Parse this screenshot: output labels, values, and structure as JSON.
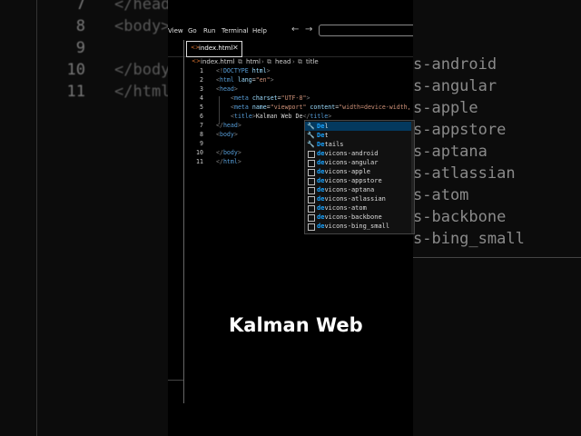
{
  "background_code": {
    "lines": [
      {
        "num": "7",
        "code": "</head"
      },
      {
        "num": "8",
        "code": "<body>"
      },
      {
        "num": "9",
        "code": ""
      },
      {
        "num": "10",
        "code": "</body"
      },
      {
        "num": "11",
        "code": "</html"
      }
    ],
    "suggestions": [
      "s-android",
      "s-angular",
      "s-apple",
      "s-appstore",
      "s-aptana",
      "s-atlassian",
      "s-atom",
      "s-backbone",
      "s-bing_small"
    ]
  },
  "menu": {
    "items": [
      "View",
      "Go",
      "Run",
      "Terminal",
      "Help"
    ],
    "back_icon": "arrow-left-icon",
    "forward_icon": "arrow-right-icon"
  },
  "tab": {
    "label": "index.html",
    "icon": "html-file-icon"
  },
  "breadcrumb": [
    "index.html",
    "html",
    "head",
    "title"
  ],
  "code_lines": [
    {
      "n": "1",
      "indent": 0,
      "parts": [
        [
          "tag",
          "<!"
        ],
        [
          "tn",
          "DOCTYPE"
        ],
        [
          "tx",
          " "
        ],
        [
          "an",
          "html"
        ],
        [
          "tag",
          ">"
        ]
      ]
    },
    {
      "n": "2",
      "indent": 0,
      "parts": [
        [
          "tag",
          "<"
        ],
        [
          "tn",
          "html"
        ],
        [
          "tx",
          " "
        ],
        [
          "an",
          "lang"
        ],
        [
          "tx",
          "="
        ],
        [
          "av",
          "\"en\""
        ],
        [
          "tag",
          ">"
        ]
      ]
    },
    {
      "n": "3",
      "indent": 0,
      "parts": [
        [
          "tag",
          "<"
        ],
        [
          "tn",
          "head"
        ],
        [
          "tag",
          ">"
        ]
      ]
    },
    {
      "n": "4",
      "indent": 1,
      "parts": [
        [
          "tag",
          "<"
        ],
        [
          "tn",
          "meta"
        ],
        [
          "tx",
          " "
        ],
        [
          "an",
          "charset"
        ],
        [
          "tx",
          "="
        ],
        [
          "av",
          "\"UTF-8\""
        ],
        [
          "tag",
          ">"
        ]
      ]
    },
    {
      "n": "5",
      "indent": 1,
      "parts": [
        [
          "tag",
          "<"
        ],
        [
          "tn",
          "meta"
        ],
        [
          "tx",
          " "
        ],
        [
          "an",
          "name"
        ],
        [
          "tx",
          "="
        ],
        [
          "av",
          "\"viewport\""
        ],
        [
          "tx",
          " "
        ],
        [
          "an",
          "content"
        ],
        [
          "tx",
          "="
        ],
        [
          "av",
          "\"width=device-width,"
        ]
      ]
    },
    {
      "n": "6",
      "indent": 1,
      "parts": [
        [
          "tag",
          "<"
        ],
        [
          "tn",
          "title"
        ],
        [
          "tag",
          ">"
        ],
        [
          "tx",
          "Kalman Web De"
        ],
        [
          "tag",
          "</"
        ],
        [
          "tn",
          "title"
        ],
        [
          "tag",
          ">"
        ]
      ]
    },
    {
      "n": "7",
      "indent": 0,
      "parts": [
        [
          "tag",
          "</"
        ],
        [
          "tn",
          "head"
        ],
        [
          "tag",
          ">"
        ]
      ]
    },
    {
      "n": "8",
      "indent": 0,
      "parts": [
        [
          "tag",
          "<"
        ],
        [
          "tn",
          "body"
        ],
        [
          "tag",
          ">"
        ]
      ]
    },
    {
      "n": "9",
      "indent": 0,
      "parts": []
    },
    {
      "n": "10",
      "indent": 0,
      "parts": [
        [
          "tag",
          "</"
        ],
        [
          "tn",
          "body"
        ],
        [
          "tag",
          ">"
        ]
      ]
    },
    {
      "n": "11",
      "indent": 0,
      "parts": [
        [
          "tag",
          "</"
        ],
        [
          "tn",
          "html"
        ],
        [
          "tag",
          ">"
        ]
      ]
    }
  ],
  "autocomplete": {
    "items": [
      {
        "icon": "wrench",
        "match": "De",
        "rest": "l"
      },
      {
        "icon": "wrench",
        "match": "De",
        "rest": "t"
      },
      {
        "icon": "wrench",
        "match": "De",
        "rest": "tails"
      },
      {
        "icon": "box",
        "match": "de",
        "rest": "vicons-android"
      },
      {
        "icon": "box",
        "match": "de",
        "rest": "vicons-angular"
      },
      {
        "icon": "box",
        "match": "de",
        "rest": "vicons-apple"
      },
      {
        "icon": "box",
        "match": "de",
        "rest": "vicons-appstore"
      },
      {
        "icon": "box",
        "match": "de",
        "rest": "vicons-aptana"
      },
      {
        "icon": "box",
        "match": "de",
        "rest": "vicons-atlassian"
      },
      {
        "icon": "box",
        "match": "de",
        "rest": "vicons-atom"
      },
      {
        "icon": "box",
        "match": "de",
        "rest": "vicons-backbone"
      },
      {
        "icon": "box",
        "match": "de",
        "rest": "vicons-bing_small"
      }
    ],
    "selected_index": 0
  },
  "caption": "Kalman Web",
  "colors": {
    "tag_bracket": "#808080",
    "tag_name": "#569cd6",
    "attr_name": "#9cdcfe",
    "attr_value": "#ce9178",
    "match_highlight": "#18a3ff",
    "selection": "#04395e"
  }
}
